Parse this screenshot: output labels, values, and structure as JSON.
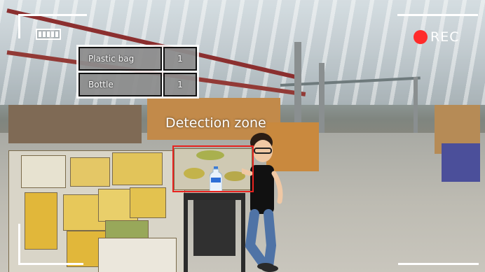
{
  "hud": {
    "rec_label": "REC",
    "battery_level": "full",
    "icons": [
      "battery-icon",
      "record-dot-icon"
    ],
    "colors": {
      "rec_dot": "#ff2b2b",
      "zone_border": "#e8231f",
      "hud_lines": "#ffffff"
    }
  },
  "counter": {
    "rows": [
      {
        "label": "Plastic bag",
        "count": "1"
      },
      {
        "label": "Bottle",
        "count": "1"
      }
    ]
  },
  "zone": {
    "title": "Detection zone"
  }
}
